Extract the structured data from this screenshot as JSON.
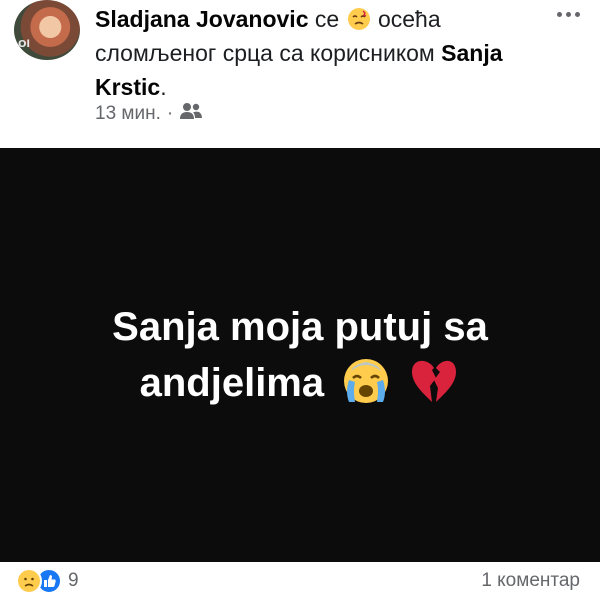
{
  "post": {
    "author": "Sladjana Jovanovic",
    "activity_prefix": " се ",
    "activity_text": " осећа сломљеног срца са корисником ",
    "tagged_user": "Sanja Krstic",
    "tagged_suffix": ".",
    "time": "13 мин.",
    "separator": " · ",
    "audience_icon": "friends-icon",
    "more_icon": "more-options-icon",
    "avatar_overlay_text": "Ol",
    "image_text": {
      "line1": "Sanja moja putuj sa",
      "line2": "andjelima"
    },
    "image_emojis": [
      "crying-face-icon",
      "broken-heart-icon"
    ]
  },
  "footer": {
    "reaction_icons": [
      "sad-reaction-icon",
      "like-reaction-icon"
    ],
    "reaction_count": "9",
    "comments_label": "1 коментар"
  },
  "colors": {
    "image_background": "#0c0c0c",
    "like_blue": "#1877f2",
    "emoji_yellow": "#ffcc4d",
    "broken_heart_red": "#d9233c",
    "muted_text": "#65676b"
  }
}
